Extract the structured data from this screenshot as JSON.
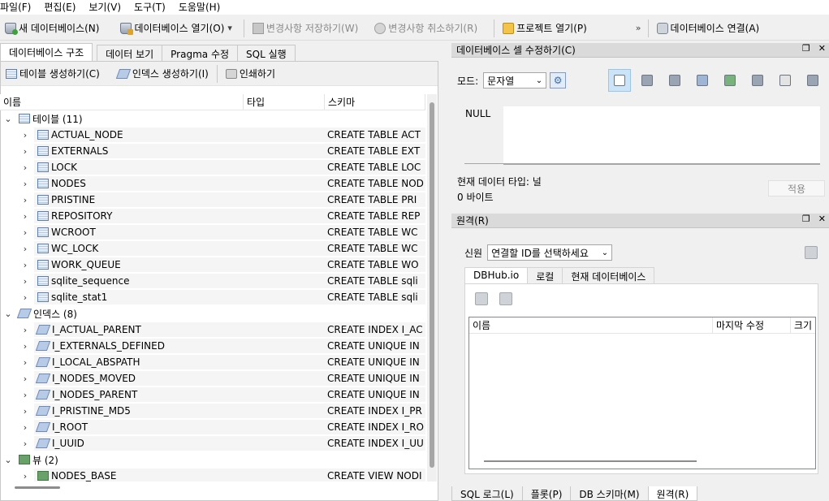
{
  "menu": [
    "파일(F)",
    "편집(E)",
    "보기(V)",
    "도구(T)",
    "도움말(H)"
  ],
  "toolbar": {
    "new_db": "새 데이터베이스(N)",
    "open_db": "데이터베이스 열기(O)",
    "write_changes": "변경사항 저장하기(W)",
    "revert_changes": "변경사항 취소하기(R)",
    "open_project": "프로젝트 열기(P)",
    "overflow": "»",
    "connect_db": "데이터베이스 연결(A)"
  },
  "left_tabs": [
    "데이터베이스 구조",
    "데이터 보기",
    "Pragma 수정",
    "SQL 실행"
  ],
  "structure_tools": {
    "create_table": "테이블 생성하기(C)",
    "create_index": "인덱스 생성하기(I)",
    "print": "인쇄하기"
  },
  "tree_headers": {
    "name": "이름",
    "type": "타입",
    "schema": "스키마"
  },
  "tree": {
    "tables_group": "테이블 (11)",
    "tables": [
      {
        "name": "ACTUAL_NODE",
        "schema": "CREATE TABLE ACT"
      },
      {
        "name": "EXTERNALS",
        "schema": "CREATE TABLE EXT"
      },
      {
        "name": "LOCK",
        "schema": "CREATE TABLE LOC"
      },
      {
        "name": "NODES",
        "schema": "CREATE TABLE NOD"
      },
      {
        "name": "PRISTINE",
        "schema": "CREATE TABLE PRI"
      },
      {
        "name": "REPOSITORY",
        "schema": "CREATE TABLE REP"
      },
      {
        "name": "WCROOT",
        "schema": "CREATE TABLE WC"
      },
      {
        "name": "WC_LOCK",
        "schema": "CREATE TABLE WC"
      },
      {
        "name": "WORK_QUEUE",
        "schema": "CREATE TABLE WO"
      },
      {
        "name": "sqlite_sequence",
        "schema": "CREATE TABLE sqli"
      },
      {
        "name": "sqlite_stat1",
        "schema": "CREATE TABLE sqli"
      }
    ],
    "indexes_group": "인덱스 (8)",
    "indexes": [
      {
        "name": "I_ACTUAL_PARENT",
        "schema": "CREATE INDEX I_AC"
      },
      {
        "name": "I_EXTERNALS_DEFINED",
        "schema": "CREATE UNIQUE IN"
      },
      {
        "name": "I_LOCAL_ABSPATH",
        "schema": "CREATE UNIQUE IN"
      },
      {
        "name": "I_NODES_MOVED",
        "schema": "CREATE UNIQUE IN"
      },
      {
        "name": "I_NODES_PARENT",
        "schema": "CREATE UNIQUE IN"
      },
      {
        "name": "I_PRISTINE_MD5",
        "schema": "CREATE INDEX I_PR"
      },
      {
        "name": "I_ROOT",
        "schema": "CREATE INDEX I_RO"
      },
      {
        "name": "I_UUID",
        "schema": "CREATE INDEX I_UU"
      }
    ],
    "views_group": "뷰 (2)",
    "views": [
      {
        "name": "NODES_BASE",
        "schema": "CREATE VIEW NODI"
      }
    ]
  },
  "cell_editor": {
    "title": "데이터베이스 셀 수정하기(C)",
    "mode_label": "모드:",
    "mode_value": "문자열",
    "null_label": "NULL",
    "data_type": "현재 데이터 타입: 널",
    "data_size": "0 바이트",
    "apply": "적용"
  },
  "remote": {
    "title": "원격(R)",
    "identity_label": "신원",
    "identity_placeholder": "연결할 ID를 선택하세요",
    "tabs": [
      "DBHub.io",
      "로컬",
      "현재 데이터베이스"
    ],
    "columns": [
      "이름",
      "마지막 수정",
      "크기"
    ]
  },
  "bottom_tabs": [
    "SQL 로그(L)",
    "플롯(P)",
    "DB 스키마(M)",
    "원격(R)"
  ]
}
